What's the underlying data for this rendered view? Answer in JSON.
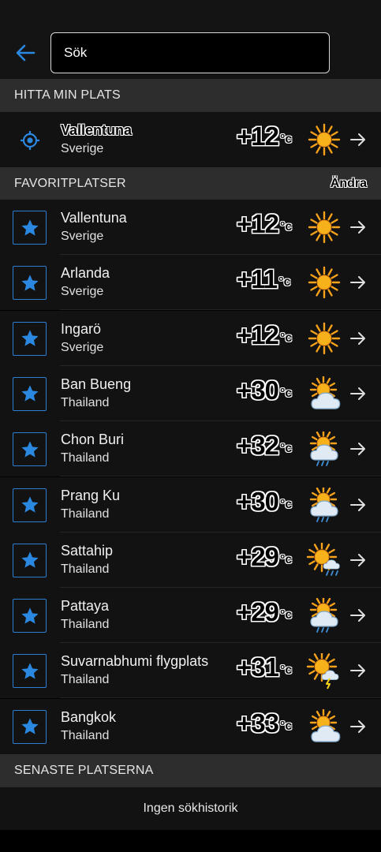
{
  "search": {
    "placeholder": "Sök"
  },
  "sections": {
    "my_location": "HITTA MIN PLATS",
    "favorites": "FAVORITPLATSER",
    "favorites_edit": "Ändra",
    "recent": "SENASTE PLATSERNA",
    "recent_empty": "Ingen sökhistorik"
  },
  "current_location": {
    "place": "Vallentuna",
    "country": "Sverige",
    "temp": "+12",
    "unit": "°c",
    "icon": "sun-icon"
  },
  "favorites": [
    {
      "place": "Vallentuna",
      "country": "Sverige",
      "temp": "+12",
      "unit": "°c",
      "icon": "sun-icon"
    },
    {
      "place": "Arlanda",
      "country": "Sverige",
      "temp": "+11",
      "unit": "°c",
      "icon": "sun-icon"
    },
    {
      "place": "Ingarö",
      "country": "Sverige",
      "temp": "+12",
      "unit": "°c",
      "icon": "sun-icon"
    },
    {
      "place": "Ban Bueng",
      "country": "Thailand",
      "temp": "+30",
      "unit": "°c",
      "icon": "partly-cloudy-icon"
    },
    {
      "place": "Chon Buri",
      "country": "Thailand",
      "temp": "+32",
      "unit": "°c",
      "icon": "sun-cloud-rain-icon"
    },
    {
      "place": "Prang Ku",
      "country": "Thailand",
      "temp": "+30",
      "unit": "°c",
      "icon": "sun-cloud-rain-icon"
    },
    {
      "place": "Sattahip",
      "country": "Thailand",
      "temp": "+29",
      "unit": "°c",
      "icon": "sun-small-cloud-rain-icon"
    },
    {
      "place": "Pattaya",
      "country": "Thailand",
      "temp": "+29",
      "unit": "°c",
      "icon": "sun-cloud-rain-icon"
    },
    {
      "place": "Suvarnabhumi flygplats",
      "country": "Thailand",
      "temp": "+31",
      "unit": "°c",
      "icon": "sun-thunder-icon"
    },
    {
      "place": "Bangkok",
      "country": "Thailand",
      "temp": "+33",
      "unit": "°c",
      "icon": "partly-cloudy-icon"
    }
  ],
  "colors": {
    "accent": "#2a7fd4",
    "sun": "#f7a21b",
    "header_bg": "#2d2d2d",
    "row_bg": "#121212"
  }
}
